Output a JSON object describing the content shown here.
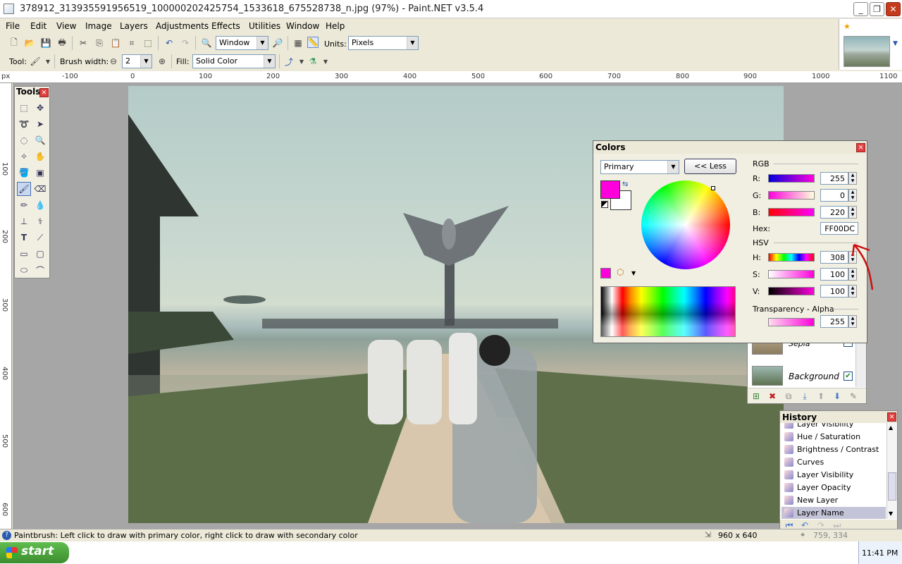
{
  "window": {
    "title": "378912_313935591956519_100000202425754_1533618_675528738_n.jpg (97%) - Paint.NET v3.5.4",
    "minimize": "_",
    "restore": "❐",
    "close": "✕"
  },
  "menu": [
    "File",
    "Edit",
    "View",
    "Image",
    "Layers",
    "Adjustments",
    "Effects",
    "Utilities",
    "Window",
    "Help"
  ],
  "toolbar": {
    "zoom_value": "Window",
    "units_label": "Units:",
    "units_value": "Pixels",
    "tool_label": "Tool:",
    "brush_width_label": "Brush width:",
    "brush_width_value": "2",
    "fill_label": "Fill:",
    "fill_value": "Solid Color"
  },
  "ruler": {
    "unit": "px",
    "h_ticks": [
      "-100",
      "0",
      "100",
      "200",
      "300",
      "400",
      "500",
      "600",
      "700",
      "800",
      "900",
      "1000",
      "1100"
    ],
    "v_ticks": [
      "100",
      "200",
      "300",
      "400",
      "500",
      "600"
    ]
  },
  "tools": {
    "title": "Tools"
  },
  "colors": {
    "title": "Colors",
    "mode": "Primary",
    "less_button": "<< Less",
    "rgb_label": "RGB",
    "r_label": "R:",
    "r_value": "255",
    "g_label": "G:",
    "g_value": "0",
    "b_label": "B:",
    "b_value": "220",
    "hex_label": "Hex:",
    "hex_value": "FF00DC",
    "hsv_label": "HSV",
    "h_label": "H:",
    "h_value": "308",
    "s_label": "S:",
    "s_value": "100",
    "v_label": "V:",
    "v_value": "100",
    "alpha_label": "Transparency - Alpha",
    "alpha_value": "255",
    "primary_color": "#ff00dc",
    "secondary_color": "#ffffff"
  },
  "layers": {
    "items": [
      "Sepia",
      "Background"
    ]
  },
  "history": {
    "title": "History",
    "items": [
      "Layer Visibility",
      "Hue / Saturation",
      "Brightness / Contrast",
      "Curves",
      "Layer Visibility",
      "Layer Opacity",
      "New Layer",
      "Layer Name"
    ]
  },
  "status": {
    "hint": "Paintbrush: Left click to draw with primary color, right click to draw with secondary color",
    "size": "960 x 640",
    "coords": "759, 334"
  },
  "taskbar": {
    "start": "start",
    "time": "11:41 PM"
  }
}
